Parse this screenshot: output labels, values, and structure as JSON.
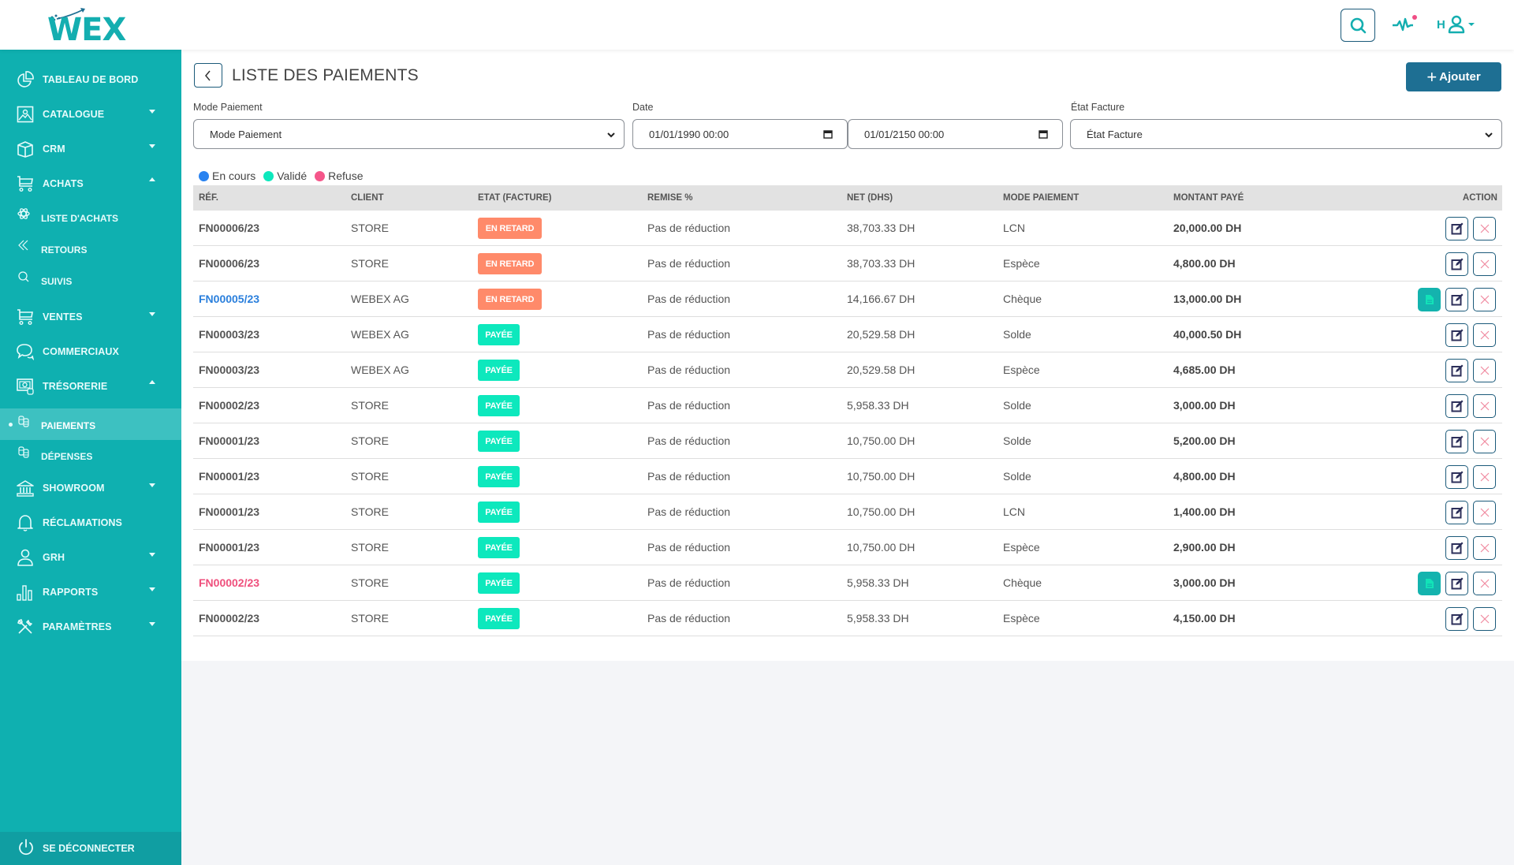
{
  "header": {
    "logo_text": "WEX",
    "user_initial": "H",
    "icons": [
      "search-icon",
      "activity-pulse-icon",
      "user-icon",
      "caret-down-icon"
    ],
    "notification_dot_color": "#f04e85"
  },
  "sidebar": {
    "items": [
      {
        "label": "TABLEAU DE BORD",
        "icon": "pie-chart-icon",
        "caret": ""
      },
      {
        "label": "CATALOGUE",
        "icon": "image-icon",
        "caret": "down"
      },
      {
        "label": "CRM",
        "icon": "box-icon",
        "caret": "down"
      },
      {
        "label": "ACHATS",
        "icon": "cart-icon",
        "caret": "up"
      },
      {
        "label": "VENTES",
        "icon": "cart-icon",
        "caret": "down"
      },
      {
        "label": "COMMERCIAUX",
        "icon": "chat-icon",
        "caret": ""
      },
      {
        "label": "TRÉSORERIE",
        "icon": "money-icon",
        "caret": "up"
      },
      {
        "label": "SHOWROOM",
        "icon": "bank-icon",
        "caret": "down"
      },
      {
        "label": "RÉCLAMATIONS",
        "icon": "bell-icon",
        "caret": ""
      },
      {
        "label": "GRH",
        "icon": "user-icon",
        "caret": "down"
      },
      {
        "label": "RAPPORTS",
        "icon": "bar-chart-icon",
        "caret": "down"
      },
      {
        "label": "PARAMÈTRES",
        "icon": "tools-icon",
        "caret": "down"
      }
    ],
    "achats_sub": [
      {
        "label": "LISTE D'ACHATS",
        "icon": "atom-icon"
      },
      {
        "label": "RETOURS",
        "icon": "double-chevron-left-icon"
      },
      {
        "label": "SUIVIS",
        "icon": "search-icon"
      }
    ],
    "tresorerie_sub": [
      {
        "label": "PAIEMENTS",
        "icon": "coins-icon",
        "active": true
      },
      {
        "label": "DÉPENSES",
        "icon": "coins-icon",
        "active": false
      }
    ],
    "logout_label": "SE DÉCONNECTER"
  },
  "page": {
    "title": "LISTE DES PAIEMENTS",
    "add_button": "Ajouter",
    "filters": {
      "mode_label": "Mode Paiement",
      "mode_value": "Mode Paiement",
      "date_label": "Date",
      "date_from": "01/01/1990 00:00",
      "date_to": "01/01/2150 00:00",
      "etat_label": "État Facture",
      "etat_value": "État Facture"
    },
    "legend": [
      {
        "label": "En cours",
        "color": "#2a83f0"
      },
      {
        "label": "Validé",
        "color": "#0de8bd"
      },
      {
        "label": "Refuse",
        "color": "#f5568a"
      }
    ]
  },
  "table": {
    "columns": [
      "RÉF.",
      "CLIENT",
      "ETAT (FACTURE)",
      "REMISE %",
      "NET (DHS)",
      "MODE PAIEMENT",
      "MONTANT PAYÉ",
      "ACTION"
    ],
    "rows": [
      {
        "ref": "FN00006/23",
        "ref_status": "",
        "client": "STORE",
        "etat": "EN RETARD",
        "etat_type": "late",
        "remise": "Pas de réduction",
        "net": "38,703.33 DH",
        "mode": "LCN",
        "montant": "20,000.00 DH",
        "has_doc": false
      },
      {
        "ref": "FN00006/23",
        "ref_status": "",
        "client": "STORE",
        "etat": "EN RETARD",
        "etat_type": "late",
        "remise": "Pas de réduction",
        "net": "38,703.33 DH",
        "mode": "Espèce",
        "montant": "4,800.00 DH",
        "has_doc": false
      },
      {
        "ref": "FN00005/23",
        "ref_status": "blue",
        "client": "WEBEX AG",
        "etat": "EN RETARD",
        "etat_type": "late",
        "remise": "Pas de réduction",
        "net": "14,166.67 DH",
        "mode": "Chèque",
        "montant": "13,000.00 DH",
        "has_doc": true
      },
      {
        "ref": "FN00003/23",
        "ref_status": "",
        "client": "WEBEX AG",
        "etat": "PAYÉE",
        "etat_type": "paid",
        "remise": "Pas de réduction",
        "net": "20,529.58 DH",
        "mode": "Solde",
        "montant": "40,000.50 DH",
        "has_doc": false
      },
      {
        "ref": "FN00003/23",
        "ref_status": "",
        "client": "WEBEX AG",
        "etat": "PAYÉE",
        "etat_type": "paid",
        "remise": "Pas de réduction",
        "net": "20,529.58 DH",
        "mode": "Espèce",
        "montant": "4,685.00 DH",
        "has_doc": false
      },
      {
        "ref": "FN00002/23",
        "ref_status": "",
        "client": "STORE",
        "etat": "PAYÉE",
        "etat_type": "paid",
        "remise": "Pas de réduction",
        "net": "5,958.33 DH",
        "mode": "Solde",
        "montant": "3,000.00 DH",
        "has_doc": false
      },
      {
        "ref": "FN00001/23",
        "ref_status": "",
        "client": "STORE",
        "etat": "PAYÉE",
        "etat_type": "paid",
        "remise": "Pas de réduction",
        "net": "10,750.00 DH",
        "mode": "Solde",
        "montant": "5,200.00 DH",
        "has_doc": false
      },
      {
        "ref": "FN00001/23",
        "ref_status": "",
        "client": "STORE",
        "etat": "PAYÉE",
        "etat_type": "paid",
        "remise": "Pas de réduction",
        "net": "10,750.00 DH",
        "mode": "Solde",
        "montant": "4,800.00 DH",
        "has_doc": false
      },
      {
        "ref": "FN00001/23",
        "ref_status": "",
        "client": "STORE",
        "etat": "PAYÉE",
        "etat_type": "paid",
        "remise": "Pas de réduction",
        "net": "10,750.00 DH",
        "mode": "LCN",
        "montant": "1,400.00 DH",
        "has_doc": false
      },
      {
        "ref": "FN00001/23",
        "ref_status": "",
        "client": "STORE",
        "etat": "PAYÉE",
        "etat_type": "paid",
        "remise": "Pas de réduction",
        "net": "10,750.00 DH",
        "mode": "Espèce",
        "montant": "2,900.00 DH",
        "has_doc": false
      },
      {
        "ref": "FN00002/23",
        "ref_status": "pink",
        "client": "STORE",
        "etat": "PAYÉE",
        "etat_type": "paid",
        "remise": "Pas de réduction",
        "net": "5,958.33 DH",
        "mode": "Chèque",
        "montant": "3,000.00 DH",
        "has_doc": true
      },
      {
        "ref": "FN00002/23",
        "ref_status": "",
        "client": "STORE",
        "etat": "PAYÉE",
        "etat_type": "paid",
        "remise": "Pas de réduction",
        "net": "5,958.33 DH",
        "mode": "Espèce",
        "montant": "4,150.00 DH",
        "has_doc": false
      }
    ]
  }
}
